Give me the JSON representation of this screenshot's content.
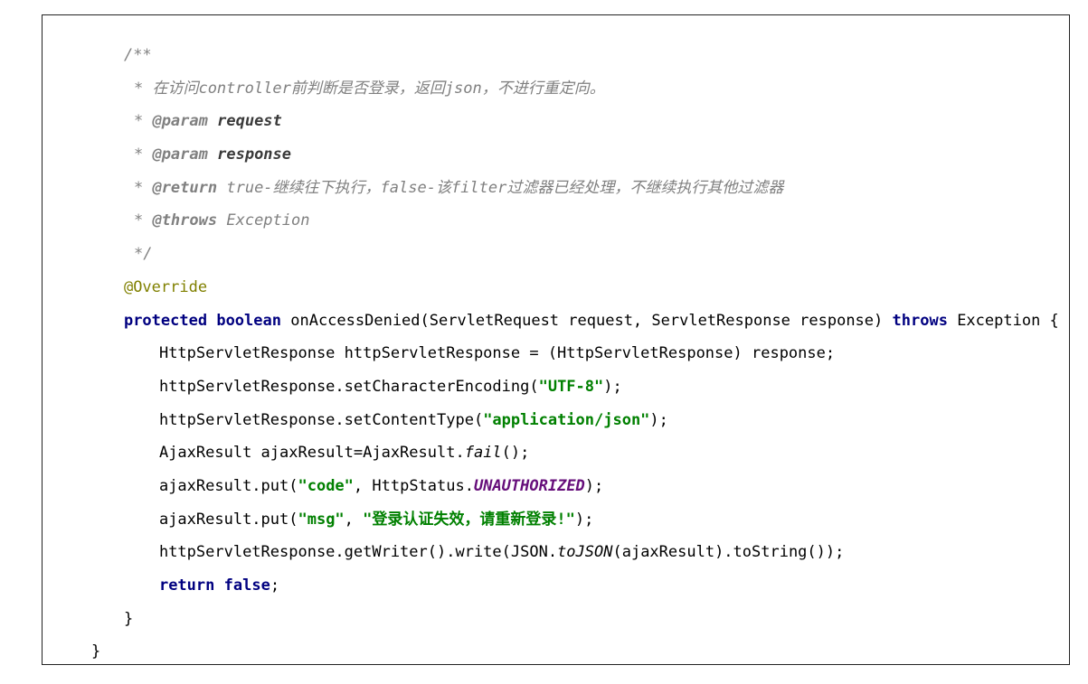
{
  "code": {
    "javadoc_open": "/**",
    "javadoc_star": "*",
    "javadoc_desc": "在访问controller前判断是否登录，返回json，不进行重定向。",
    "param_tag": "@param",
    "param_request": "request",
    "param_response": "response",
    "return_tag": "@return",
    "return_desc": "true-继续往下执行，false-该filter过滤器已经处理，不继续执行其他过滤器",
    "throws_tag": "@throws",
    "throws_desc": "Exception",
    "javadoc_close": "*/",
    "annotation": "@Override",
    "kw_protected": "protected",
    "kw_boolean": "boolean",
    "method_signature": "onAccessDenied(ServletRequest request, ServletResponse response)",
    "kw_throws": "throws",
    "signature_end": "Exception {",
    "line_cast": "HttpServletResponse httpServletResponse = (HttpServletResponse) response;",
    "line_encoding_start": "httpServletResponse.setCharacterEncoding(",
    "str_utf8": "\"UTF-8\"",
    "line_end_paren_semi": ");",
    "line_contenttype_start": "httpServletResponse.setContentType(",
    "str_json": "\"application/json\"",
    "line_ajax_start": "AjaxResult ajaxResult=AjaxResult.",
    "call_fail": "fail",
    "line_ajax_end": "();",
    "line_put_start": "ajaxResult.put(",
    "str_code": "\"code\"",
    "put_code_mid": ", HttpStatus.",
    "field_unauthorized": "UNAUTHORIZED",
    "str_msg": "\"msg\"",
    "comma_space": ", ",
    "str_msg_value": "\"登录认证失效，请重新登录!\"",
    "line_writer_start": "httpServletResponse.getWriter().write(JSON.",
    "call_tojson": "toJSON",
    "line_writer_end": "(ajaxResult).toString());",
    "kw_return": "return",
    "kw_false": "false",
    "semicolon": ";",
    "close_method": "}",
    "close_class": "}"
  }
}
